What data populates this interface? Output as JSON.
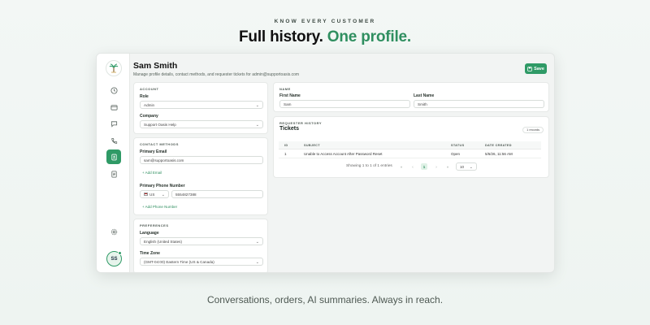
{
  "hero": {
    "eyebrow": "KNOW EVERY CUSTOMER",
    "headline_main": "Full history.",
    "headline_accent": "One profile.",
    "footer": "Conversations, orders, AI summaries. Always in reach."
  },
  "profile": {
    "name": "Sam Smith",
    "subtitle": "Manage profile details, contact methods, and requester tickets for admin@supportoasis.com",
    "save_label": "Save"
  },
  "account": {
    "section": "ACCOUNT",
    "role_label": "Role",
    "role_value": "Admin",
    "company_label": "Company",
    "company_value": "Support Oasis Help"
  },
  "contact": {
    "section": "CONTACT METHODS",
    "email_label": "Primary Email",
    "email_value": "sam@supportoasis.com",
    "add_email": "Add Email",
    "phone_label": "Primary Phone Number",
    "country": "US",
    "phone_value": "5554827388",
    "add_phone": "Add Phone Number"
  },
  "preferences": {
    "section": "PREFERENCES",
    "language_label": "Language",
    "language_value": "English (United States)",
    "timezone_label": "Time Zone",
    "timezone_value": "(GMT-04:00) Eastern Time (US & Canada)"
  },
  "name_card": {
    "section": "NAME",
    "first_label": "First Name",
    "first_value": "Sam",
    "last_label": "Last Name",
    "last_value": "Smith"
  },
  "tickets": {
    "section": "REQUESTER HISTORY",
    "title": "Tickets",
    "records": "1 records",
    "columns": [
      "ID",
      "SUBJECT",
      "STATUS",
      "DATE CREATED"
    ],
    "rows": [
      {
        "id": "1",
        "subject": "Unable to Access Account After Password Reset",
        "status": "Open",
        "date": "5/6/26, 11:56 AM"
      }
    ],
    "pagination_text": "Showing 1 to 1 of 1 entries",
    "first_page": "«",
    "prev_page": "‹",
    "current_page": "1",
    "next_page": "›",
    "last_page": "»",
    "page_size": "10"
  },
  "icons": {
    "accent": "#2f9a66",
    "rail": [
      "clock-icon",
      "ticket-icon",
      "chat-icon",
      "phone-icon",
      "contacts-icon",
      "document-icon",
      "settings-icon"
    ]
  },
  "avatar": {
    "initials": "SS"
  }
}
